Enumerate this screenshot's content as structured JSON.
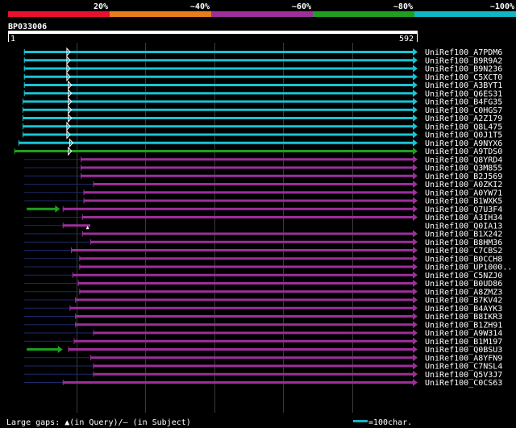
{
  "identity_scale": {
    "labels": [
      "20%",
      "~40%",
      "~60%",
      "~80%",
      "~100%"
    ],
    "colors": [
      "#e8112d",
      "#e87d1e",
      "#9c2f9a",
      "#1f9e1f",
      "#12b5c4"
    ]
  },
  "query": {
    "name": "BP033006",
    "start": "1",
    "end": "592",
    "length": 592
  },
  "hits": [
    {
      "name": "UniRef100_A7PDM6",
      "color": "#19c3d3",
      "q": [
        24,
        592
      ],
      "mk": [
        86
      ]
    },
    {
      "name": "UniRef100_B9R9A2",
      "color": "#19c3d3",
      "q": [
        24,
        592
      ],
      "mk": [
        86
      ]
    },
    {
      "name": "UniRef100_B9N236",
      "color": "#19c3d3",
      "q": [
        24,
        592
      ],
      "mk": [
        86
      ]
    },
    {
      "name": "UniRef100_C5XCT0",
      "color": "#19c3d3",
      "q": [
        24,
        592
      ],
      "mk": [
        86
      ]
    },
    {
      "name": "UniRef100_A3BYT1",
      "color": "#19c3d3",
      "q": [
        24,
        592
      ],
      "mk": [
        88
      ]
    },
    {
      "name": "UniRef100_Q6ES31",
      "color": "#19c3d3",
      "q": [
        24,
        592
      ],
      "mk": [
        88
      ]
    },
    {
      "name": "UniRef100_B4FG35",
      "color": "#19c3d3",
      "q": [
        22,
        592
      ],
      "mk": [
        88
      ]
    },
    {
      "name": "UniRef100_C0HGS7",
      "color": "#19c3d3",
      "q": [
        22,
        592
      ],
      "mk": [
        88
      ]
    },
    {
      "name": "UniRef100_A2Z179",
      "color": "#19c3d3",
      "q": [
        22,
        592
      ],
      "mk": [
        88
      ]
    },
    {
      "name": "UniRef100_Q8L475",
      "color": "#19c3d3",
      "q": [
        22,
        592
      ],
      "mk": [
        86
      ]
    },
    {
      "name": "UniRef100_Q0J1T5",
      "color": "#19c3d3",
      "q": [
        22,
        592
      ],
      "mk": [
        86
      ]
    },
    {
      "name": "UniRef100_A9NYX6",
      "color": "#19c3d3",
      "q": [
        16,
        592
      ],
      "mk": [
        90
      ]
    },
    {
      "name": "UniRef100_A9TDS0",
      "color": "#1f9e1f",
      "q": [
        10,
        592
      ],
      "mk": [
        88
      ]
    },
    {
      "name": "UniRef100_Q8YRD4",
      "color": "#9c2f9a",
      "q": [
        106,
        592
      ],
      "tail": [
        24,
        106
      ]
    },
    {
      "name": "UniRef100_Q3M855",
      "color": "#9c2f9a",
      "q": [
        106,
        592
      ],
      "tail": [
        24,
        106
      ]
    },
    {
      "name": "UniRef100_B2J569",
      "color": "#9c2f9a",
      "q": [
        106,
        592
      ],
      "tail": [
        24,
        106
      ]
    },
    {
      "name": "UniRef100_A0ZKI2",
      "color": "#9c2f9a",
      "q": [
        124,
        592
      ],
      "tail": [
        24,
        124
      ]
    },
    {
      "name": "UniRef100_A0YW71",
      "color": "#9c2f9a",
      "q": [
        110,
        592
      ],
      "tail": [
        24,
        110
      ]
    },
    {
      "name": "UniRef100_B1WXK5",
      "color": "#9c2f9a",
      "q": [
        110,
        592
      ],
      "tail": [
        24,
        110
      ]
    },
    {
      "name": "UniRef100_Q7U3F4",
      "color": "#9c2f9a",
      "q": [
        80,
        592
      ],
      "pre": [
        28,
        76
      ]
    },
    {
      "name": "UniRef100_A3IH34",
      "color": "#9c2f9a",
      "q": [
        108,
        592
      ],
      "tail": [
        24,
        108
      ]
    },
    {
      "name": "UniRef100_Q0IA13",
      "color": "#9c2f9a",
      "q": [
        80,
        120
      ],
      "tail": [
        24,
        80
      ],
      "caret": 116
    },
    {
      "name": "UniRef100_B1X242",
      "color": "#9c2f9a",
      "q": [
        108,
        592
      ],
      "tail": [
        24,
        108
      ]
    },
    {
      "name": "UniRef100_B8HM36",
      "color": "#9c2f9a",
      "q": [
        120,
        592
      ],
      "tail": [
        24,
        120
      ]
    },
    {
      "name": "UniRef100_C7CBS2",
      "color": "#9c2f9a",
      "q": [
        92,
        592
      ],
      "tail": [
        24,
        92
      ]
    },
    {
      "name": "UniRef100_B0CCH8",
      "color": "#9c2f9a",
      "q": [
        104,
        592
      ],
      "tail": [
        24,
        104
      ]
    },
    {
      "name": "UniRef100_UP1000..",
      "color": "#9c2f9a",
      "q": [
        104,
        592
      ],
      "tail": [
        24,
        104
      ]
    },
    {
      "name": "UniRef100_C5NZJ0",
      "color": "#9c2f9a",
      "q": [
        94,
        592
      ],
      "tail": [
        24,
        94
      ]
    },
    {
      "name": "UniRef100_B0UD86",
      "color": "#9c2f9a",
      "q": [
        102,
        592
      ],
      "tail": [
        24,
        102
      ]
    },
    {
      "name": "UniRef100_A8ZMZ3",
      "color": "#9c2f9a",
      "q": [
        104,
        592
      ],
      "tail": [
        24,
        104
      ]
    },
    {
      "name": "UniRef100_B7KV42",
      "color": "#9c2f9a",
      "q": [
        98,
        592
      ],
      "tail": [
        24,
        98
      ]
    },
    {
      "name": "UniRef100_B4AYK3",
      "color": "#9c2f9a",
      "q": [
        90,
        592
      ],
      "tail": [
        24,
        90
      ]
    },
    {
      "name": "UniRef100_B8IKR3",
      "color": "#9c2f9a",
      "q": [
        98,
        592
      ],
      "tail": [
        24,
        98
      ]
    },
    {
      "name": "UniRef100_B1ZH91",
      "color": "#9c2f9a",
      "q": [
        98,
        592
      ],
      "tail": [
        24,
        98
      ]
    },
    {
      "name": "UniRef100_A9W314",
      "color": "#9c2f9a",
      "q": [
        124,
        592
      ],
      "tail": [
        24,
        124
      ]
    },
    {
      "name": "UniRef100_B1M197",
      "color": "#9c2f9a",
      "q": [
        96,
        592
      ],
      "tail": [
        24,
        96
      ]
    },
    {
      "name": "UniRef100_Q0BSU3",
      "color": "#9c2f9a",
      "q": [
        88,
        592
      ],
      "pre": [
        28,
        80
      ]
    },
    {
      "name": "UniRef100_A8YFN9",
      "color": "#9c2f9a",
      "q": [
        120,
        592
      ],
      "tail": [
        24,
        120
      ]
    },
    {
      "name": "UniRef100_C7NSL4",
      "color": "#9c2f9a",
      "q": [
        124,
        592
      ],
      "tail": [
        24,
        124
      ]
    },
    {
      "name": "UniRef100_Q5V3J7",
      "color": "#9c2f9a",
      "q": [
        124,
        592
      ],
      "tail": [
        24,
        124
      ]
    },
    {
      "name": "UniRef100_C0CS63",
      "color": "#9c2f9a",
      "q": [
        80,
        592
      ],
      "tail": [
        24,
        80
      ]
    }
  ],
  "footer": {
    "gaps_prefix": "Large gaps: ",
    "gaps_query": "(in Query)/",
    "gaps_subject": "– (in Subject)",
    "scale_text": "=100char.",
    "scale_color": "#12b5c4"
  }
}
